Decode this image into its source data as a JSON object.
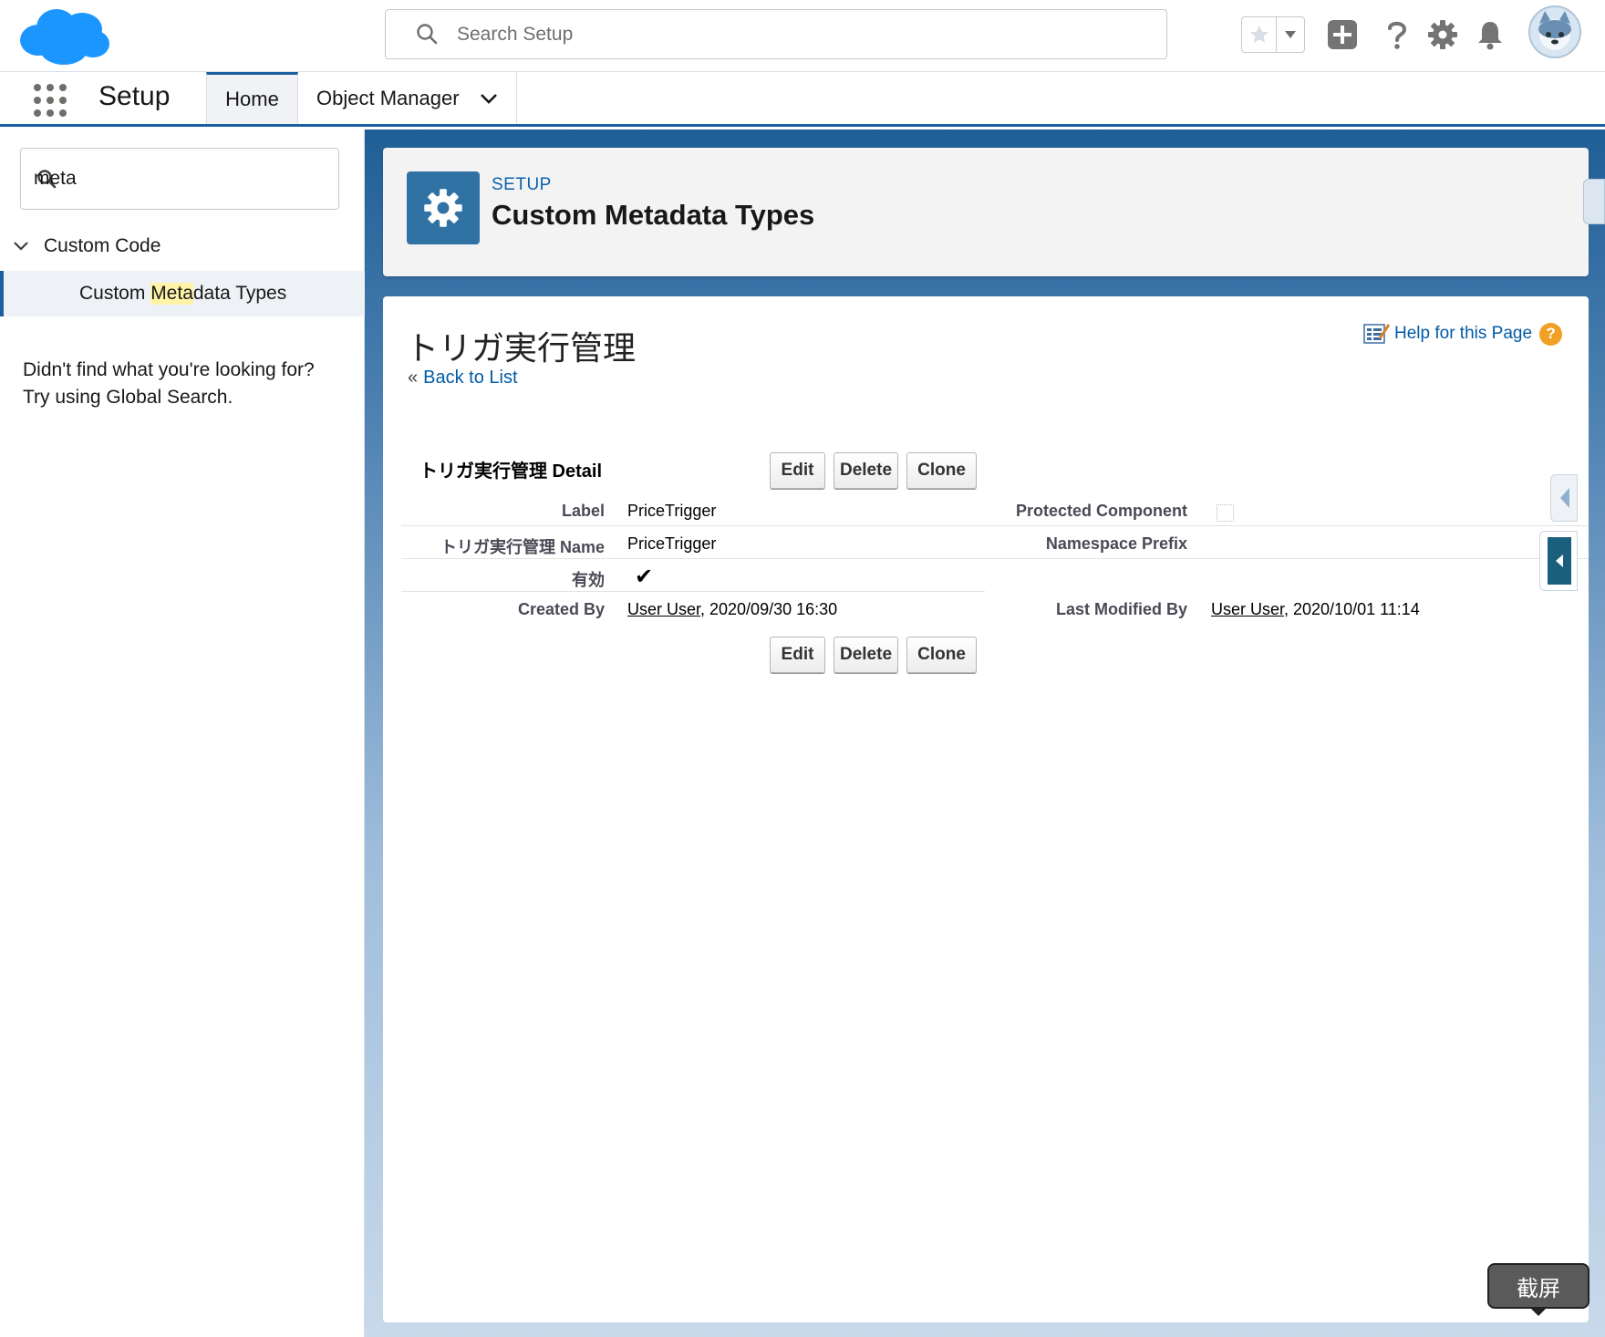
{
  "header": {
    "search_placeholder": "Search Setup"
  },
  "context_bar": {
    "app_name": "Setup",
    "tabs": [
      {
        "label": "Home"
      },
      {
        "label": "Object Manager"
      }
    ]
  },
  "sidebar": {
    "quickfind_value": "meta",
    "group_label": "Custom Code",
    "item_prefix": "Custom ",
    "item_highlight": "Meta",
    "item_suffix": "data Types",
    "not_found_line1": "Didn't find what you're looking for?",
    "not_found_line2": "Try using Global Search."
  },
  "page_header": {
    "eyebrow": "SETUP",
    "title": "Custom Metadata Types"
  },
  "record": {
    "title": "トリガ実行管理",
    "back_prefix": "«",
    "back_link": "Back to List",
    "help_link": "Help for this Page",
    "help_icon": "?",
    "detail_title": "トリガ実行管理 Detail",
    "buttons": {
      "edit": "Edit",
      "delete": "Delete",
      "clone": "Clone"
    },
    "fields": {
      "label_label": "Label",
      "label_value": "PriceTrigger",
      "protected_label": "Protected Component",
      "name_label": "トリガ実行管理 Name",
      "name_value": "PriceTrigger",
      "namespace_label": "Namespace Prefix",
      "active_label": "有効",
      "active_mark": "✔",
      "created_label": "Created By",
      "created_user": "User User",
      "created_date": ", 2020/09/30 16:30",
      "modified_label": "Last Modified By",
      "modified_user": "User User",
      "modified_date": ", 2020/10/01 11:14"
    }
  },
  "overlay": {
    "screenshot_label": "截屏"
  },
  "colors": {
    "brand": "#1b96ff",
    "link": "#015ba7",
    "nav_accent": "#1b5f9e"
  },
  "icons": [
    "salesforce-logo",
    "search-icon",
    "star-icon",
    "chevron-down-icon",
    "add-icon",
    "help-icon",
    "gear-icon",
    "bell-icon",
    "avatar",
    "app-launcher-icon",
    "setup-gear-icon",
    "help-page-icon"
  ]
}
